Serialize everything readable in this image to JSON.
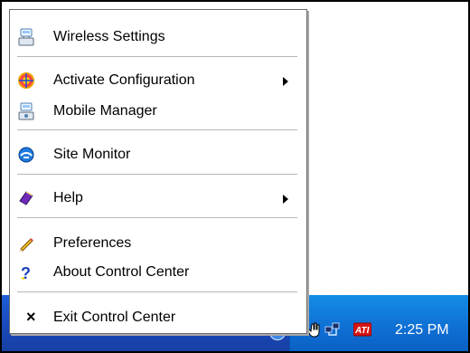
{
  "menu": {
    "items": [
      {
        "label": "Wireless Settings",
        "icon": "wireless-settings-icon",
        "has_submenu": false
      },
      {
        "label": "Activate Configuration",
        "icon": "activate-configuration-icon",
        "has_submenu": true
      },
      {
        "label": "Mobile Manager",
        "icon": "mobile-manager-icon",
        "has_submenu": false
      },
      {
        "label": "Site Monitor",
        "icon": "site-monitor-icon",
        "has_submenu": false
      },
      {
        "label": "Help",
        "icon": "help-book-icon",
        "has_submenu": true
      },
      {
        "label": "Preferences",
        "icon": "pencil-icon",
        "has_submenu": false
      },
      {
        "label": "About Control Center",
        "icon": "question-mark-icon",
        "has_submenu": false
      },
      {
        "label": "Exit Control Center",
        "icon": "x-icon",
        "has_submenu": false
      }
    ]
  },
  "taskbar": {
    "clock": "2:25 PM",
    "tray_icons": [
      "show-hidden-icons-arrow",
      "network-icon",
      "ati-icon"
    ],
    "accent": "#1f5fd8",
    "tray_color": "#0f6fd4"
  },
  "icons": {
    "wireless": "wireless-settings-icon",
    "activate": "activate-configuration-icon",
    "mobile": "mobile-manager-icon",
    "site": "site-monitor-icon",
    "help": "help-book-icon",
    "preferences": "pencil-icon",
    "about": "question-mark-icon",
    "exit": "x-icon"
  }
}
